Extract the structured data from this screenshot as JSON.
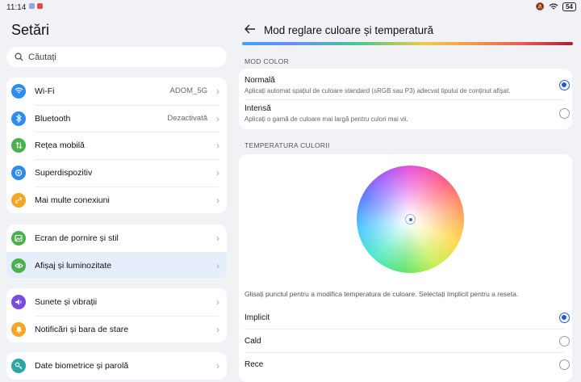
{
  "status": {
    "time": "11:14",
    "battery": "54"
  },
  "left": {
    "title": "Setări",
    "search_placeholder": "Căutați",
    "groups": [
      [
        {
          "label": "Wi-Fi",
          "value": "ADOM_5G",
          "icon": "wifi-icon",
          "color": "#2e8cf0"
        },
        {
          "label": "Bluetooth",
          "value": "Dezactivată",
          "icon": "bluetooth-icon",
          "color": "#2e8cf0"
        },
        {
          "label": "Rețea mobilă",
          "value": "",
          "icon": "mobile-network-icon",
          "color": "#4caf50"
        },
        {
          "label": "Superdispozitiv",
          "value": "",
          "icon": "superdevice-icon",
          "color": "#2e8cf0"
        },
        {
          "label": "Mai multe conexiuni",
          "value": "",
          "icon": "link-icon",
          "color": "#f5a623"
        }
      ],
      [
        {
          "label": "Ecran de pornire și stil",
          "value": "",
          "icon": "home-screen-icon",
          "color": "#4caf50"
        },
        {
          "label": "Afișaj și luminozitate",
          "value": "",
          "icon": "display-icon",
          "color": "#4caf50"
        }
      ],
      [
        {
          "label": "Sunete și vibrații",
          "value": "",
          "icon": "sound-icon",
          "color": "#7b4be0"
        },
        {
          "label": "Notificări și bara de stare",
          "value": "",
          "icon": "bell-icon",
          "color": "#f5a623"
        }
      ],
      [
        {
          "label": "Date biometrice și parolă",
          "value": "",
          "icon": "key-icon",
          "color": "#2ca6a4"
        }
      ]
    ]
  },
  "right": {
    "title": "Mod reglare culoare și temperatură",
    "mode_label": "MOD COLOR",
    "modes": [
      {
        "title": "Normală",
        "desc": "Aplicați automat spațiul de culoare standard (sRGB sau P3) adecvat tipului de conținut afișat.",
        "selected": true
      },
      {
        "title": "Intensă",
        "desc": "Aplicați o gamă de culoare mai largă pentru culori mai vii.",
        "selected": false
      }
    ],
    "temp_label": "TEMPERATURA CULORII",
    "hint": "Glisați punctul pentru a modifica temperatura de culoare. Selectați Implicit pentru a reseta.",
    "temps": [
      {
        "label": "Implicit",
        "selected": true
      },
      {
        "label": "Cald",
        "selected": false
      },
      {
        "label": "Rece",
        "selected": false
      }
    ],
    "accent": "#1a5ad8"
  }
}
